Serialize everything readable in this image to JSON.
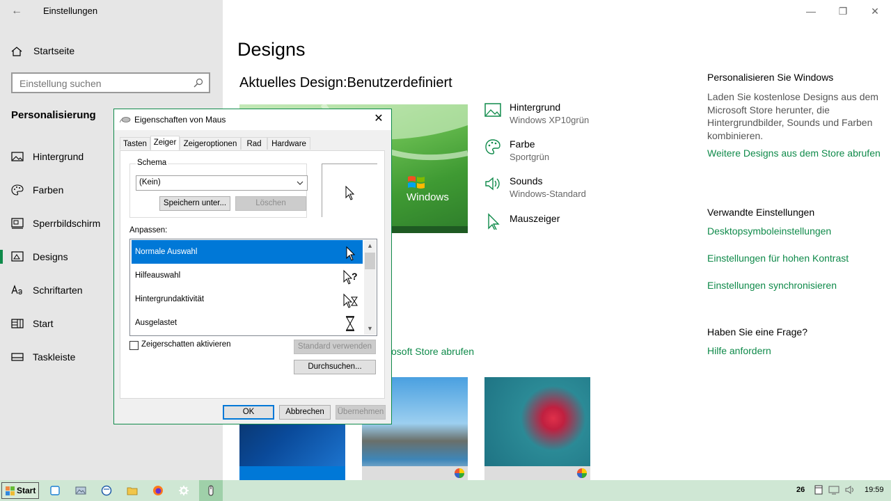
{
  "settings": {
    "window_title": "Einstellungen",
    "home": "Startseite",
    "search_placeholder": "Einstellung suchen",
    "section": "Personalisierung",
    "nav": [
      {
        "label": "Hintergrund",
        "icon": "picture-icon"
      },
      {
        "label": "Farben",
        "icon": "palette-icon"
      },
      {
        "label": "Sperrbildschirm",
        "icon": "lockscreen-icon"
      },
      {
        "label": "Designs",
        "icon": "designs-icon",
        "active": true
      },
      {
        "label": "Schriftarten",
        "icon": "fonts-icon"
      },
      {
        "label": "Start",
        "icon": "start-icon"
      },
      {
        "label": "Taskleiste",
        "icon": "taskbar-icon"
      }
    ]
  },
  "main": {
    "title": "Designs",
    "current_design_label": "Aktuelles Design:",
    "current_design_value": "Benutzerdefiniert",
    "preview_logo": "Windows",
    "props": [
      {
        "title": "Hintergrund",
        "value": "Windows XP10grün",
        "icon": "picture-icon"
      },
      {
        "title": "Farbe",
        "value": "Sportgrün",
        "icon": "palette-icon"
      },
      {
        "title": "Sounds",
        "value": "Windows-Standard",
        "icon": "speaker-icon"
      },
      {
        "title": "Mauszeiger",
        "value": "",
        "icon": "cursor-icon"
      }
    ],
    "store_link": "osoft Store abrufen"
  },
  "right": {
    "personalize_heading": "Personalisieren Sie Windows",
    "personalize_text": "Laden Sie kostenlose Designs aus dem Microsoft Store herunter, die Hintergrundbilder, Sounds und Farben kombinieren.",
    "more_designs_link": "Weitere Designs aus dem Store abrufen",
    "related_heading": "Verwandte Einstellungen",
    "related_links": [
      "Desktopsymboleinstellungen",
      "Einstellungen für hohen Kontrast",
      "Einstellungen synchronisieren"
    ],
    "question_heading": "Haben Sie eine Frage?",
    "help_link": "Hilfe anfordern"
  },
  "dialog": {
    "title": "Eigenschaften von Maus",
    "tabs": [
      "Tasten",
      "Zeiger",
      "Zeigeroptionen",
      "Rad",
      "Hardware"
    ],
    "selected_tab": "Zeiger",
    "schema_label": "Schema",
    "schema_value": "(Kein)",
    "save_as": "Speichern unter...",
    "delete": "Löschen",
    "customize_label": "Anpassen:",
    "cursors": [
      {
        "label": "Normale Auswahl",
        "icon": "arrow-cursor-icon",
        "selected": true
      },
      {
        "label": "Hilfeauswahl",
        "icon": "help-cursor-icon"
      },
      {
        "label": "Hintergrundaktivität",
        "icon": "working-cursor-icon"
      },
      {
        "label": "Ausgelastet",
        "icon": "busy-cursor-icon"
      }
    ],
    "shadow_checkbox": "Zeigerschatten aktivieren",
    "shadow_checked": false,
    "use_default": "Standard verwenden",
    "browse": "Durchsuchen...",
    "ok": "OK",
    "cancel": "Abbrechen",
    "apply": "Übernehmen"
  },
  "taskbar": {
    "start": "Start",
    "tray_number": "26",
    "clock": "19:59"
  },
  "colors": {
    "accent": "#0f8a4a",
    "selection": "#0078d7",
    "nav_background": "#e6e6e6",
    "taskbar": "#cfe7d4"
  }
}
